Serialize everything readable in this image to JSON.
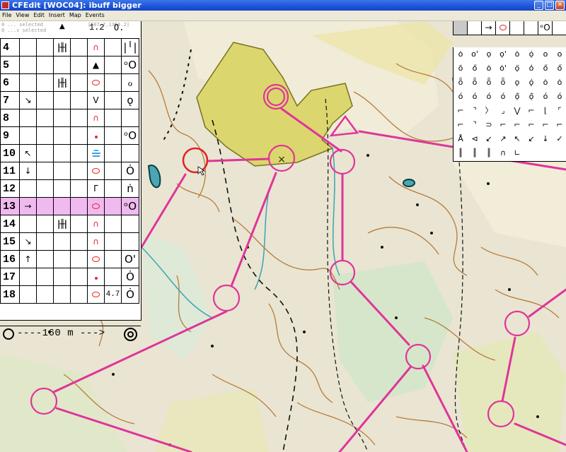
{
  "window": {
    "title": "CFEdit [WOC04]: ibuff bigger",
    "buttons": {
      "minimize": "_",
      "maximize": "□",
      "close": "✕"
    }
  },
  "menu": [
    "File",
    "View",
    "Edit",
    "Insert",
    "Map",
    "Events"
  ],
  "description_sheet": {
    "status_line1": "0 ... selected",
    "status_line2": "0 ...s selected",
    "coordinates": "[507.7,1364.2]",
    "header_value": "1.2",
    "rows": [
      {
        "num": "4",
        "c4": "parallel-icon",
        "c6": "red-curve-icon",
        "c8": "|╵|"
      },
      {
        "num": "5",
        "c6": "▲",
        "c8": "ᵒO"
      },
      {
        "num": "6",
        "c4": "parallel-icon",
        "c6": "red-oval-icon",
        "c8": "ℴ"
      },
      {
        "num": "7",
        "c2": "↘",
        "c6": "V",
        "c8": "ǫ"
      },
      {
        "num": "8",
        "c6": "red-curve-icon"
      },
      {
        "num": "9",
        "c6": "red-dot-icon",
        "c8": "ᵒO"
      },
      {
        "num": "10",
        "c2": "↖",
        "c6": "blue-lined-icon"
      },
      {
        "num": "11",
        "c2": "↓",
        "c6": "red-oval-icon",
        "c8": "Ȯ"
      },
      {
        "num": "12",
        "c6": "Γ",
        "c8": "ṅ"
      },
      {
        "num": "13",
        "c2": "→",
        "c6": "red-oval-icon",
        "c8": "ᵒO",
        "selected": true
      },
      {
        "num": "14",
        "c4": "parallel-icon",
        "c6": "red-curve-icon"
      },
      {
        "num": "15",
        "c2": "↘",
        "c6": "red-curve-icon"
      },
      {
        "num": "16",
        "c2": "↑",
        "c6": "red-oval-icon",
        "c8": "O'"
      },
      {
        "num": "17",
        "c6": "red-dot-icon",
        "c8": "Ȯ"
      },
      {
        "num": "18",
        "c6": "red-oval-icon",
        "c7": "4.7",
        "c8": "Ȯ"
      }
    ],
    "footer_text": "----160 m --->"
  },
  "palette": {
    "top": [
      "",
      "",
      "→",
      "oval",
      "",
      "ᵒO",
      ""
    ],
    "symbols": [
      "ȯ",
      "o'",
      "ọ",
      "ọ'",
      "ȯ",
      "ọ̇",
      "o",
      "o",
      "ō",
      "ő",
      "ȯ",
      "ȯ'",
      "ọ̈",
      "ȯ̇",
      "ő",
      "ő",
      "ȫ",
      "ȫ",
      "ȫ",
      "ȫ",
      "ǫ",
      "ǫ̇",
      "ȯ",
      "ȯ",
      "ó",
      "ó",
      "ó",
      "ó",
      "ọ̃",
      "ọ̃",
      "ó",
      "ó",
      "⌐",
      "⌝",
      "〉",
      "⌟",
      "⋁",
      "⌐",
      "⌊",
      "⌜",
      "⌐",
      "⌝",
      "⊃",
      "⌐",
      "⌐",
      "⌐",
      "⌐",
      "⌐",
      "Å",
      "⊲",
      "↙",
      "↗",
      "↖",
      "↙",
      "↓",
      "✓",
      "║",
      "║",
      "║",
      "∩",
      "∟",
      "",
      "",
      ""
    ]
  },
  "map": {
    "colors": {
      "course": "#e0349a",
      "contour": "#b87a3c",
      "forest": "#e6e2cc",
      "yellow": "#dcd66e",
      "green": "#9dd3a6",
      "red_circle": "#e12022"
    },
    "control_centre_label": "×"
  }
}
